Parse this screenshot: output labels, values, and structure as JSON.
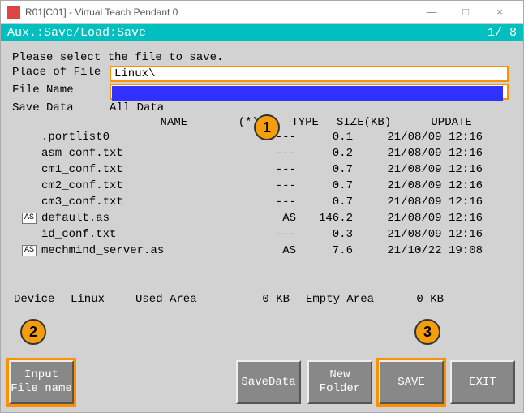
{
  "titlebar": {
    "text": "R01[C01] - Virtual Teach Pendant 0",
    "min": "—",
    "max": "□",
    "close": "×"
  },
  "aux": {
    "path": "Aux.:Save/Load:Save",
    "page": "1/ 8"
  },
  "prompt": "Please select the file to save.",
  "place": {
    "label": "Place of File",
    "value": "Linux\\"
  },
  "filename": {
    "label": "File Name",
    "value": ""
  },
  "savedata": {
    "label": "Save Data",
    "value": "All Data"
  },
  "headers": {
    "name": "NAME",
    "star": "(*)",
    "type": "TYPE",
    "size": "SIZE(KB)",
    "update": "UPDATE"
  },
  "files": [
    {
      "icon": "",
      "name": ".portlist0",
      "type": "---",
      "size": "0.1",
      "update": "21/08/09 12:16"
    },
    {
      "icon": "",
      "name": "asm_conf.txt",
      "type": "---",
      "size": "0.2",
      "update": "21/08/09 12:16"
    },
    {
      "icon": "",
      "name": "cm1_conf.txt",
      "type": "---",
      "size": "0.7",
      "update": "21/08/09 12:16"
    },
    {
      "icon": "",
      "name": "cm2_conf.txt",
      "type": "---",
      "size": "0.7",
      "update": "21/08/09 12:16"
    },
    {
      "icon": "",
      "name": "cm3_conf.txt",
      "type": "---",
      "size": "0.7",
      "update": "21/08/09 12:16"
    },
    {
      "icon": "AS",
      "name": "default.as",
      "type": "AS",
      "size": "146.2",
      "update": "21/08/09 12:16"
    },
    {
      "icon": "",
      "name": "id_conf.txt",
      "type": "---",
      "size": "0.3",
      "update": "21/08/09 12:16"
    },
    {
      "icon": "AS",
      "name": "mechmind_server.as",
      "type": "AS",
      "size": "7.6",
      "update": "21/10/22 19:08"
    }
  ],
  "device": {
    "label": "Device",
    "value": "Linux",
    "used_label": "Used Area",
    "used_value": "0 KB",
    "empty_label": "Empty Area",
    "empty_value": "0 KB"
  },
  "buttons": {
    "input": "Input\nFile name",
    "savedata": "SaveData",
    "newfolder": "New\nFolder",
    "save": "SAVE",
    "exit": "EXIT"
  },
  "callouts": {
    "c1": "1",
    "c2": "2",
    "c3": "3"
  }
}
